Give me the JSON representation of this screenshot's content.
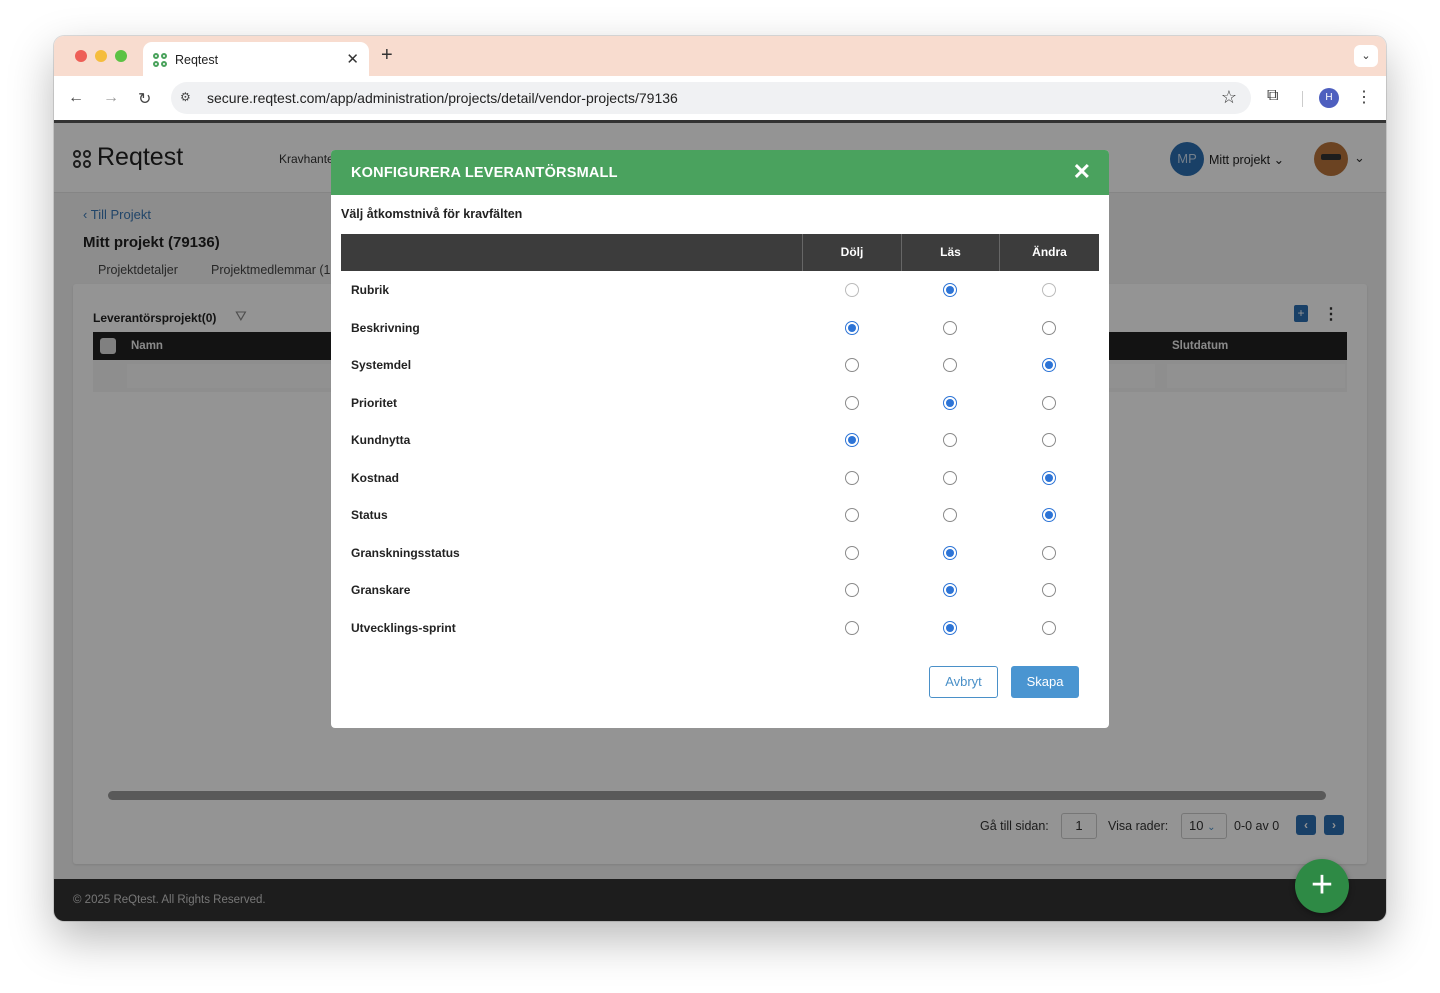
{
  "browser": {
    "tab_title": "Reqtest",
    "tab_close": "✕",
    "new_tab": "+",
    "url": "secure.reqtest.com/app/administration/projects/detail/vendor-projects/79136",
    "profile_initial": "H"
  },
  "app": {
    "logo": "Reqtest",
    "nav_item": "Kravhante",
    "project_avatar": "MP",
    "project_switch": "Mitt projekt",
    "back_link": "Till Projekt",
    "page_title": "Mitt projekt (79136)",
    "subtabs": [
      "Projektdetaljer",
      "Projektmedlemmar (1"
    ]
  },
  "panel": {
    "title": "Leverantörsprojekt(0)",
    "columns": [
      "Namn",
      "Slutdatum"
    ],
    "pager": {
      "goto_label": "Gå till sidan:",
      "goto_value": "1",
      "rows_label": "Visa rader:",
      "rows_value": "10",
      "range": "0-0 av 0"
    }
  },
  "footer": {
    "text": "© 2025 ReQtest. All Rights Reserved."
  },
  "modal": {
    "title": "KONFIGURERA LEVERANTÖRSMALL",
    "subtitle": "Välj åtkomstnivå för kravfälten",
    "columns": [
      "Dölj",
      "Läs",
      "Ändra"
    ],
    "fields": [
      {
        "label": "Rubrik",
        "selected": "Läs"
      },
      {
        "label": "Beskrivning",
        "selected": "Dölj"
      },
      {
        "label": "Systemdel",
        "selected": "Ändra"
      },
      {
        "label": "Prioritet",
        "selected": "Läs"
      },
      {
        "label": "Kundnytta",
        "selected": "Dölj"
      },
      {
        "label": "Kostnad",
        "selected": "Ändra"
      },
      {
        "label": "Status",
        "selected": "Ändra"
      },
      {
        "label": "Granskningsstatus",
        "selected": "Läs"
      },
      {
        "label": "Granskare",
        "selected": "Läs"
      },
      {
        "label": "Utvecklings-sprint",
        "selected": "Läs"
      }
    ],
    "cancel_label": "Avbryt",
    "create_label": "Skapa"
  },
  "colors": {
    "modal_header": "#4aa25e",
    "primary": "#4a95d1",
    "radio_selected": "#2d74d6",
    "fab": "#2e8a45"
  }
}
